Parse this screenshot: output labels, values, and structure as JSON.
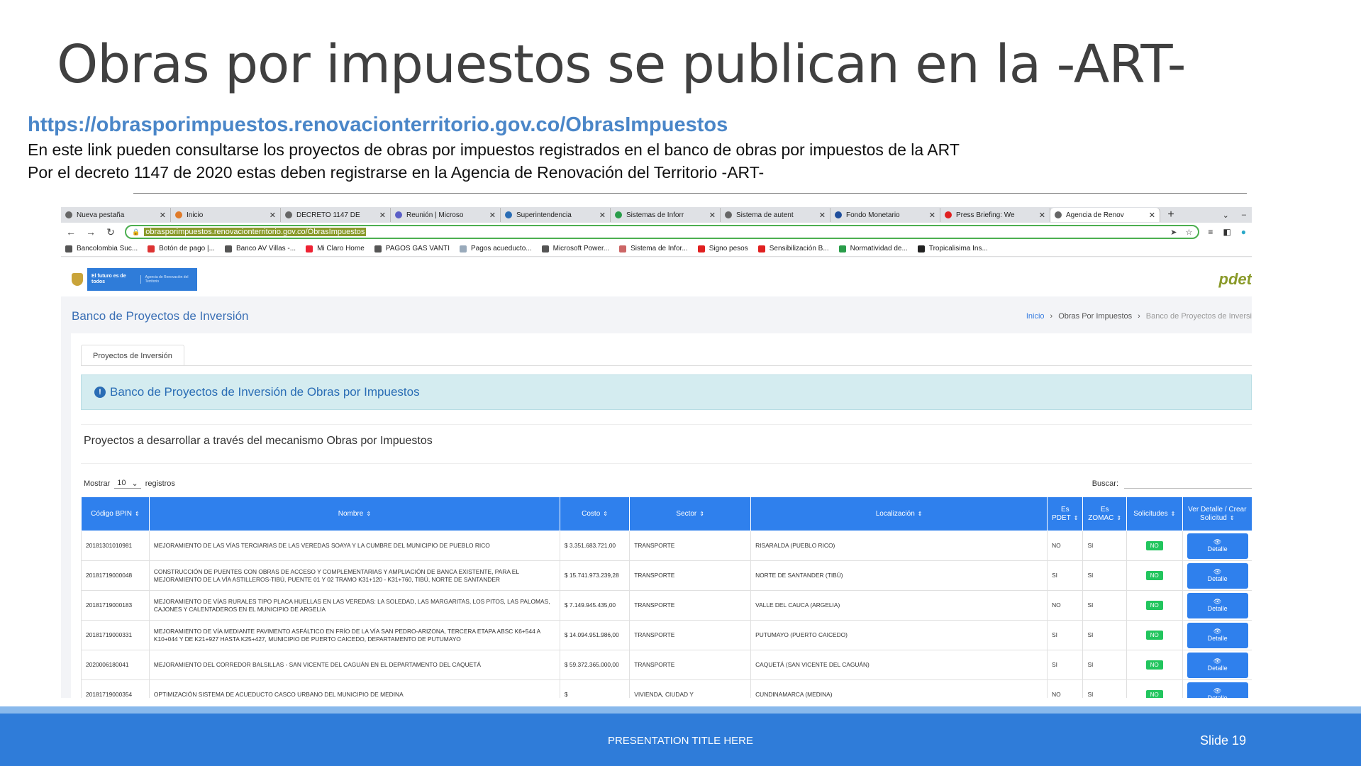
{
  "slide": {
    "title": "Obras por impuestos se publican en la -ART-",
    "link": "https://obrasporimpuestos.renovacionterritorio.gov.co/ObrasImpuestos",
    "line1": "En este link pueden consultarse los proyectos de obras por impuestos registrados en el banco de obras por impuestos de la ART",
    "line2": "Por el decreto 1147 de 2020 estas deben registrarse en la Agencia de Renovación del Territorio -ART-",
    "footer_title": "PRESENTATION TITLE HERE",
    "slide_number": "Slide 19"
  },
  "browser": {
    "tabs": [
      {
        "label": "Nueva pestaña"
      },
      {
        "label": "Inicio"
      },
      {
        "label": "DECRETO 1147 DE"
      },
      {
        "label": "Reunión | Microso"
      },
      {
        "label": "Superintendencia"
      },
      {
        "label": "Sistemas de Inforr"
      },
      {
        "label": "Sistema de autent"
      },
      {
        "label": "Fondo Monetario"
      },
      {
        "label": "Press Briefing: We"
      },
      {
        "label": "Agencia de Renov"
      }
    ],
    "url": "obrasporimpuestos.renovacionterritorio.gov.co/ObrasImpuestos",
    "bookmarks": [
      {
        "label": "Bancolombia Suc..."
      },
      {
        "label": "Botón de pago |..."
      },
      {
        "label": "Banco AV Villas -..."
      },
      {
        "label": "Mi Claro Home"
      },
      {
        "label": "PAGOS GAS VANTI"
      },
      {
        "label": "Pagos acueducto..."
      },
      {
        "label": "Microsoft Power..."
      },
      {
        "label": "Sistema de Infor..."
      },
      {
        "label": "Signo pesos"
      },
      {
        "label": "Sensibilización B..."
      },
      {
        "label": "Normatividad de..."
      },
      {
        "label": "Tropicalisima Ins..."
      }
    ]
  },
  "site": {
    "logo_line1": "El futuro es de todos",
    "logo_line2": "Agencia de Renovación del Territorio",
    "pdet_logo": "pdet",
    "page_heading": "Banco de Proyectos de Inversión",
    "breadcrumb": [
      "Inicio",
      "Obras Por Impuestos",
      "Banco de Proyectos de Inversi"
    ],
    "tab_label": "Proyectos de Inversión",
    "alert_text": "Banco de Proyectos de Inversión de Obras por Impuestos",
    "subheading": "Proyectos a desarrollar a través del mecanismo Obras por Impuestos",
    "show_label": "Mostrar",
    "show_value": "10",
    "records_label": "registros",
    "search_label": "Buscar:",
    "columns": [
      "Código BPIN",
      "Nombre",
      "Costo",
      "Sector",
      "Localización",
      "Es PDET",
      "Es ZOMAC",
      "Solicitudes",
      "Ver Detalle / Crear Solicitud"
    ],
    "detail_label": "Detalle",
    "rows": [
      {
        "bpin": "20181301010981",
        "nombre": "MEJORAMIENTO DE LAS VÍAS TERCIARIAS DE LAS VEREDAS SOAYA Y LA CUMBRE DEL MUNICIPIO DE PUEBLO RICO",
        "costo": "$ 3.351.683.721,00",
        "sector": "TRANSPORTE",
        "loc": "RISARALDA (PUEBLO RICO)",
        "pdet": "NO",
        "zomac": "SI",
        "sol": "NO"
      },
      {
        "bpin": "20181719000048",
        "nombre": "CONSTRUCCIÓN DE PUENTES CON OBRAS DE ACCESO Y COMPLEMENTARIAS Y AMPLIACIÓN DE BANCA EXISTENTE, PARA EL MEJORAMIENTO DE LA VÍA ASTILLEROS-TIBÚ, PUENTE 01 Y 02 TRAMO K31+120 - K31+760, TIBÚ, NORTE DE SANTANDER",
        "costo": "$ 15.741.973.239,28",
        "sector": "TRANSPORTE",
        "loc": "NORTE DE SANTANDER (TIBÚ)",
        "pdet": "SI",
        "zomac": "SI",
        "sol": "NO"
      },
      {
        "bpin": "20181719000183",
        "nombre": "MEJORAMIENTO DE VÍAS RURALES TIPO PLACA HUELLAS EN LAS VEREDAS: LA SOLEDAD, LAS MARGARITAS, LOS PITOS, LAS PALOMAS, CAJONES Y CALENTADEROS EN EL MUNICIPIO DE ARGELIA",
        "costo": "$ 7.149.945.435,00",
        "sector": "TRANSPORTE",
        "loc": "VALLE DEL CAUCA (ARGELIA)",
        "pdet": "NO",
        "zomac": "SI",
        "sol": "NO"
      },
      {
        "bpin": "20181719000331",
        "nombre": "MEJORAMIENTO DE VÍA MEDIANTE PAVIMENTO ASFÁLTICO EN FRÍO DE LA VÍA SAN PEDRO-ARIZONA, TERCERA ETAPA ABSC K6+544 A K10+044 Y DE K21+927 HASTA K25+427, MUNICIPIO DE PUERTO CAICEDO, DEPARTAMENTO DE PUTUMAYO",
        "costo": "$ 14.094.951.986,00",
        "sector": "TRANSPORTE",
        "loc": "PUTUMAYO (PUERTO CAICEDO)",
        "pdet": "SI",
        "zomac": "SI",
        "sol": "NO"
      },
      {
        "bpin": "2020006180041",
        "nombre": "MEJORAMIENTO DEL CORREDOR BALSILLAS - SAN VICENTE DEL CAGUÁN EN EL DEPARTAMENTO DEL CAQUETÁ",
        "costo": "$ 59.372.365.000,00",
        "sector": "TRANSPORTE",
        "loc": "CAQUETÁ (SAN VICENTE DEL CAGUÁN)",
        "pdet": "SI",
        "zomac": "SI",
        "sol": "NO"
      },
      {
        "bpin": "20181719000354",
        "nombre": "OPTIMIZACIÓN SISTEMA DE ACUEDUCTO CASCO URBANO DEL MUNICIPIO DE MEDINA",
        "costo": "$",
        "sector": "VIVIENDA, CIUDAD Y",
        "loc": "CUNDINAMARCA (MEDINA)",
        "pdet": "NO",
        "zomac": "SI",
        "sol": "NO"
      }
    ]
  },
  "colors": {
    "accent": "#2f80ed",
    "footer": "#2f7cd9",
    "link": "#4a86c8",
    "badge": "#22c55e",
    "alert_bg": "#d4ecf0"
  }
}
